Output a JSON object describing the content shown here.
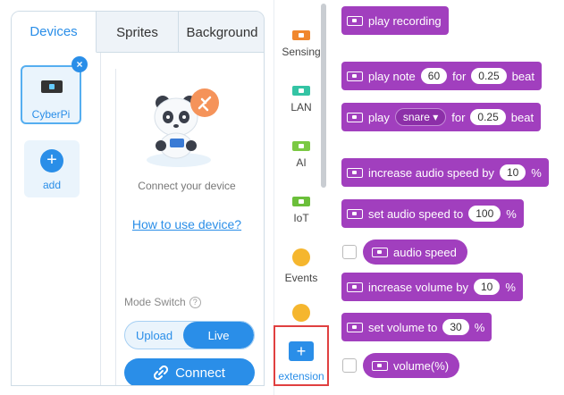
{
  "tabs": {
    "devices": "Devices",
    "sprites": "Sprites",
    "background": "Background"
  },
  "device": {
    "name": "CyberPi",
    "close": "×"
  },
  "add": {
    "plus": "+",
    "label": "add"
  },
  "connect": {
    "hint": "Connect your device",
    "howto": "How to use device?",
    "mode_switch": "Mode Switch",
    "help": "?",
    "upload": "Upload",
    "live": "Live",
    "connect_button": "Connect"
  },
  "categories": [
    {
      "label": "Sensing",
      "icon": "orange-board-icon",
      "color": "#f0872d"
    },
    {
      "label": "LAN",
      "icon": "teal-board-icon",
      "color": "#34c4a4"
    },
    {
      "label": "AI",
      "icon": "green-board-icon",
      "color": "#7ac943"
    },
    {
      "label": "IoT",
      "icon": "green-board-icon",
      "color": "#6bbf3a"
    },
    {
      "label": "Events",
      "icon": "events-circle-icon",
      "color": "#f5b62e"
    },
    {
      "label": "",
      "icon": "control-circle-icon",
      "color": "#f5b62e"
    }
  ],
  "extension": {
    "label": "extension",
    "plus": "+"
  },
  "blocks": {
    "play_recording": "play recording",
    "play_note": {
      "pre": "play note",
      "note": "60",
      "mid": "for",
      "beats": "0.25",
      "post": "beat"
    },
    "play_drum": {
      "pre": "play",
      "drum": "snare ▾",
      "mid": "for",
      "beats": "0.25",
      "post": "beat"
    },
    "inc_speed": {
      "pre": "increase audio speed by",
      "value": "10",
      "post": "%"
    },
    "set_speed": {
      "pre": "set audio speed to",
      "value": "100",
      "post": "%"
    },
    "audio_speed": "audio speed",
    "inc_volume": {
      "pre": "increase volume by",
      "value": "10",
      "post": "%"
    },
    "set_volume": {
      "pre": "set volume to",
      "value": "30",
      "post": "%"
    },
    "volume": "volume(%)"
  },
  "colors": {
    "accent": "#2a8ee8",
    "block": "#a13fbe",
    "highlight": "#e04040"
  }
}
